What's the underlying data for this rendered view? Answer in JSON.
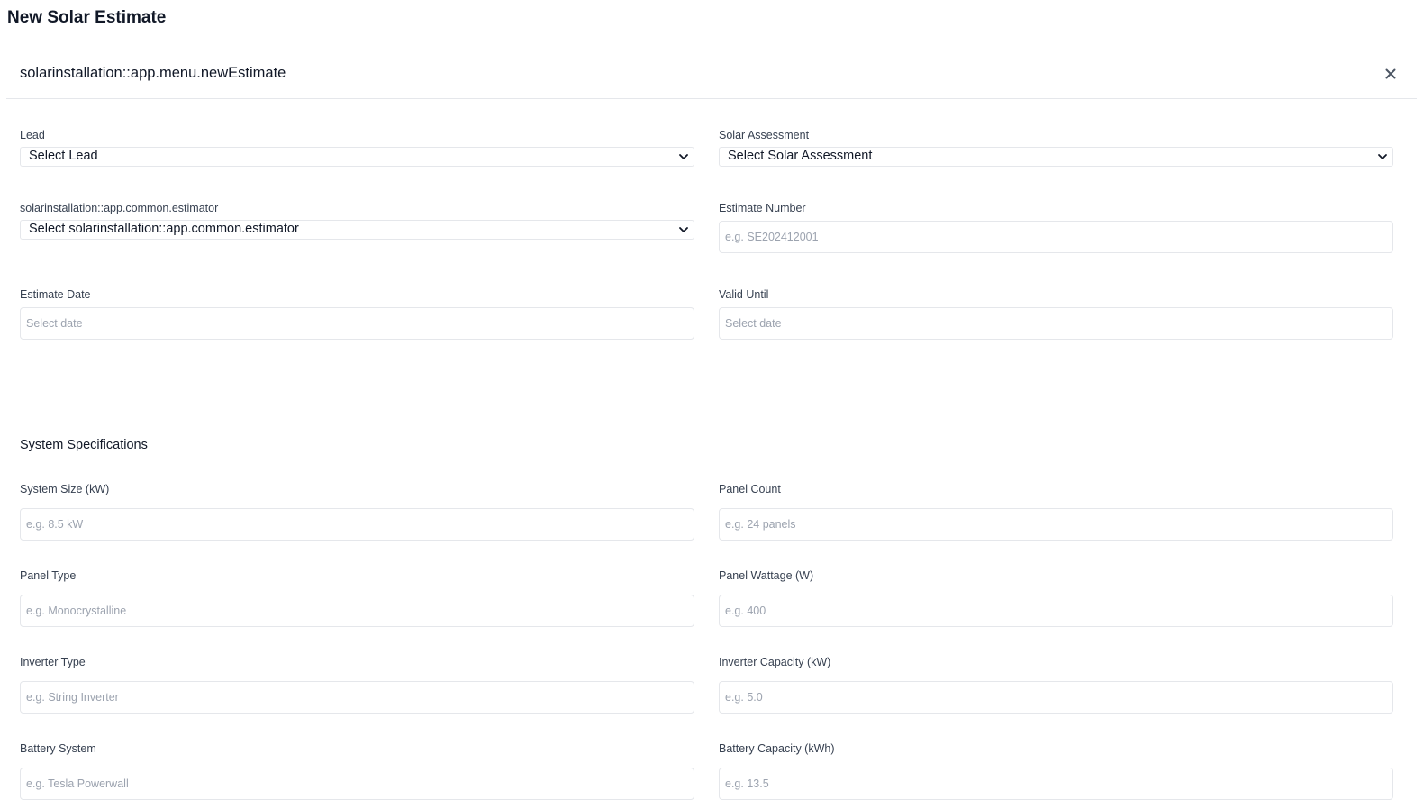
{
  "page": {
    "title": "New Solar Estimate"
  },
  "modal": {
    "title": "solarinstallation::app.menu.newEstimate",
    "close_icon": "close-icon"
  },
  "fields": {
    "lead": {
      "label": "Lead",
      "value": "Select Lead"
    },
    "solar_assessment": {
      "label": "Solar Assessment",
      "value": "Select Solar Assessment"
    },
    "estimator": {
      "label": "solarinstallation::app.common.estimator",
      "value": "Select solarinstallation::app.common.estimator"
    },
    "estimate_number": {
      "label": "Estimate Number",
      "placeholder": "e.g. SE202412001"
    },
    "estimate_date": {
      "label": "Estimate Date",
      "placeholder": "Select date"
    },
    "valid_until": {
      "label": "Valid Until",
      "placeholder": "Select date"
    }
  },
  "system_specifications": {
    "title": "System Specifications",
    "system_size": {
      "label": "System Size (kW)",
      "placeholder": "e.g. 8.5 kW"
    },
    "panel_count": {
      "label": "Panel Count",
      "placeholder": "e.g. 24 panels"
    },
    "panel_type": {
      "label": "Panel Type",
      "placeholder": "e.g. Monocrystalline"
    },
    "panel_wattage": {
      "label": "Panel Wattage (W)",
      "placeholder": "e.g. 400"
    },
    "inverter_type": {
      "label": "Inverter Type",
      "placeholder": "e.g. String Inverter"
    },
    "inverter_capacity": {
      "label": "Inverter Capacity (kW)",
      "placeholder": "e.g. 5.0"
    },
    "battery_system": {
      "label": "Battery System",
      "placeholder": "e.g. Tesla Powerwall"
    },
    "battery_capacity": {
      "label": "Battery Capacity (kWh)",
      "placeholder": "e.g. 13.5"
    }
  }
}
